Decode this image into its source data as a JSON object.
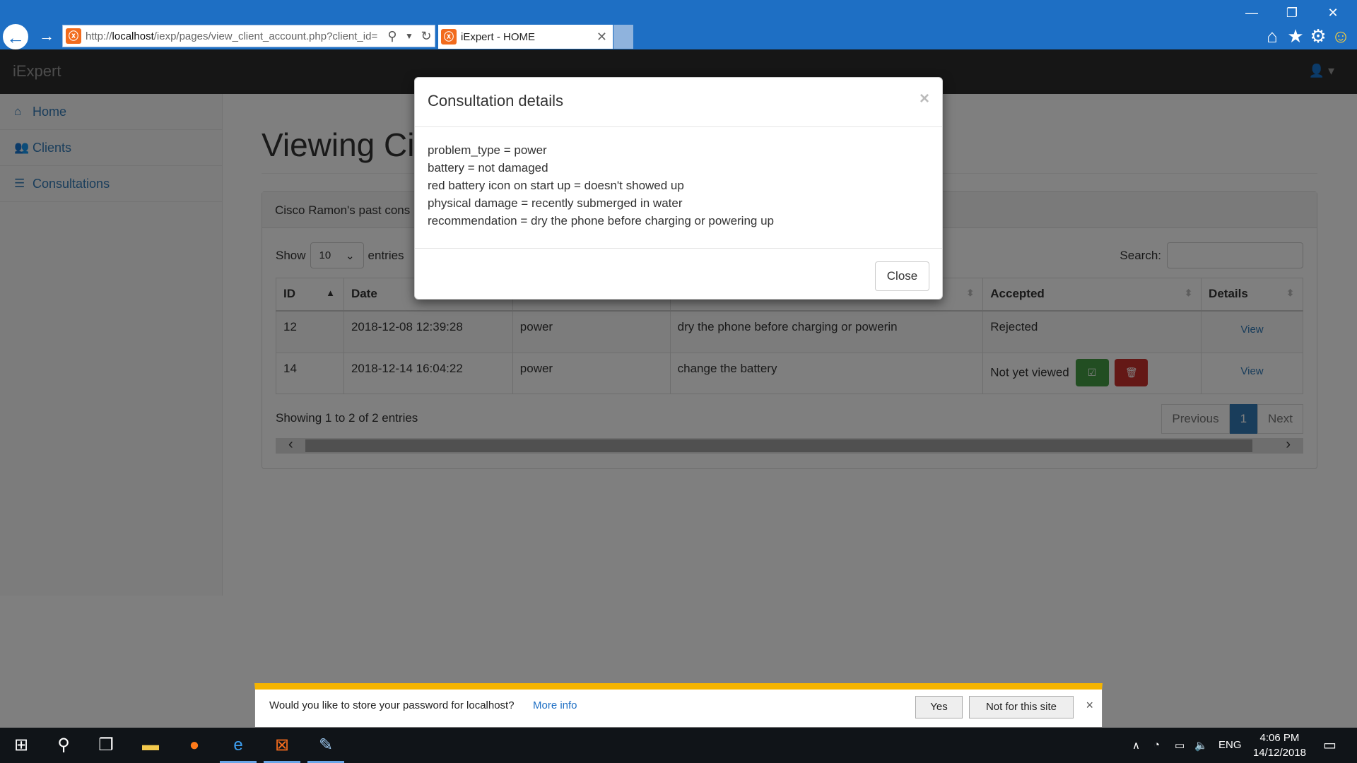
{
  "browser": {
    "url_prefix": "http://",
    "url_host": "localhost",
    "url_path": "/iexp/pages/view_client_account.php?client_id=",
    "tab_title": "iExpert - HOME",
    "favicon_glyph": "ⓧ"
  },
  "app": {
    "brand": "iExpert",
    "sidebar": [
      {
        "label": "Home",
        "icon": "home-icon"
      },
      {
        "label": "Clients",
        "icon": "users-icon"
      },
      {
        "label": "Consultations",
        "icon": "list-icon"
      }
    ],
    "page_heading": "Viewing Ci",
    "panel_heading": "Cisco Ramon's past cons",
    "length_label_pre": "Show",
    "length_value": "10",
    "length_label_post": "entries",
    "search_label": "Search:",
    "columns": [
      "ID",
      "Date",
      "",
      "",
      "Accepted",
      "Details"
    ],
    "rows": [
      {
        "id": "12",
        "date": "2018-12-08 12:39:28",
        "type": "power",
        "recommendation": "dry the phone before charging or powerin",
        "accepted": "Rejected",
        "details": "View"
      },
      {
        "id": "14",
        "date": "2018-12-14 16:04:22",
        "type": "power",
        "recommendation": "change the battery",
        "accepted": "Not yet viewed",
        "details": "View"
      }
    ],
    "info": "Showing 1 to 2 of 2 entries",
    "pager": {
      "previous": "Previous",
      "current": "1",
      "next": "Next"
    }
  },
  "modal": {
    "title": "Consultation details",
    "close_x": "×",
    "lines": [
      "problem_type = power",
      "battery = not damaged",
      "red battery icon on start up = doesn't showed up",
      "physical damage = recently submerged in water",
      "recommendation = dry the phone before charging or powering up"
    ],
    "close_button": "Close"
  },
  "password_bar": {
    "message": "Would you like to store your password for localhost?",
    "more_info": "More info",
    "yes": "Yes",
    "not_for_site": "Not for this site",
    "close": "×"
  },
  "taskbar": {
    "language": "ENG",
    "time": "4:06 PM",
    "date": "14/12/2018"
  },
  "colors": {
    "titlebar": "#1e6fc4",
    "link": "#337ab7",
    "success": "#449d44",
    "danger": "#c9302c",
    "warning_bar": "#f4b400"
  }
}
